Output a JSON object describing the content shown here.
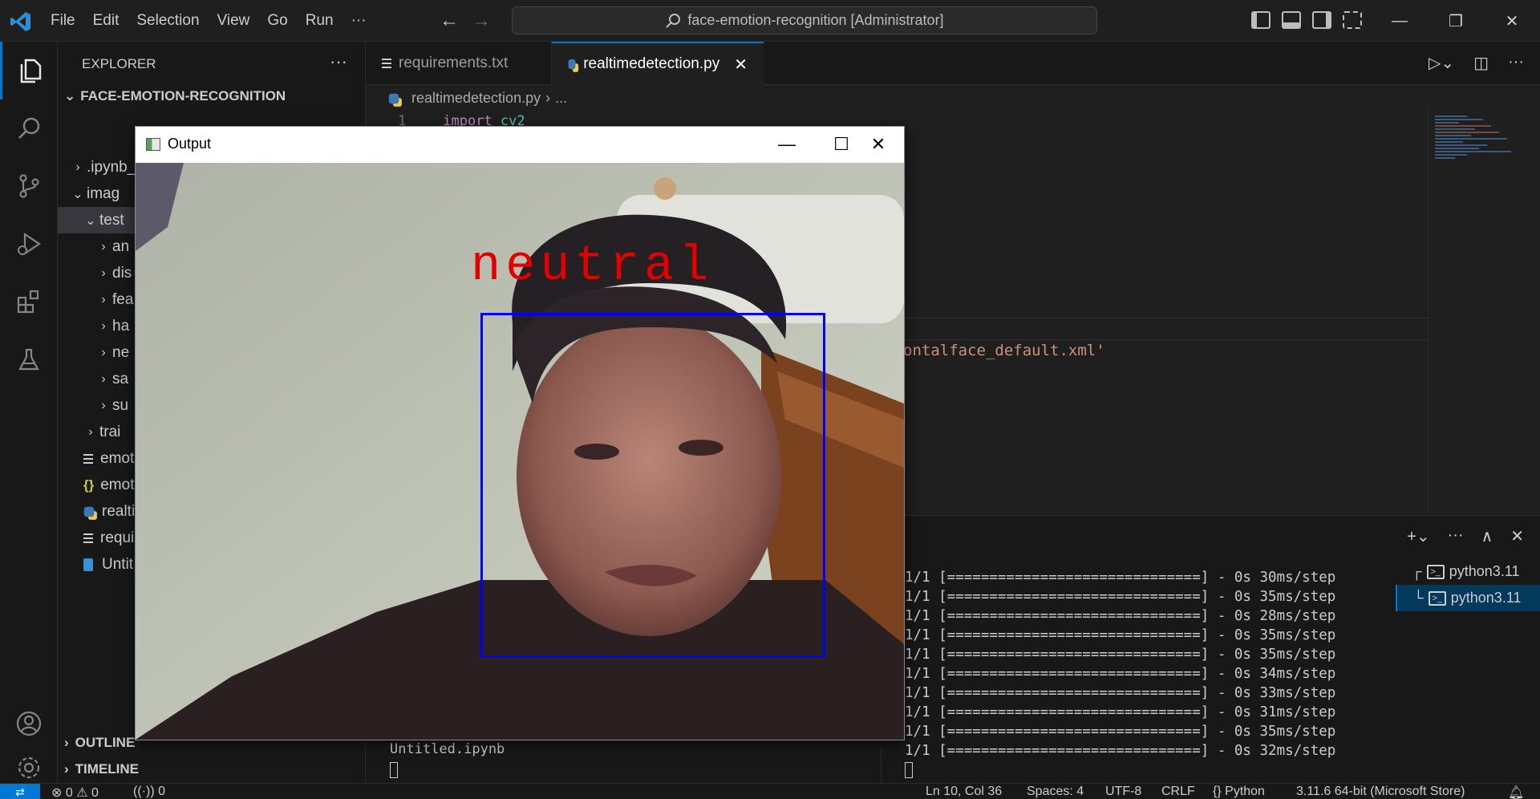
{
  "titlebar": {
    "menu": [
      "File",
      "Edit",
      "Selection",
      "View",
      "Go",
      "Run",
      "···"
    ],
    "command_center": "face-emotion-recognition [Administrator]"
  },
  "sidebar": {
    "title": "EXPLORER",
    "more": "···",
    "root": "FACE-EMOTION-RECOGNITION",
    "items": [
      {
        "label": ".ipynb_checkpoints",
        "chev": ">"
      },
      {
        "label": "imag",
        "chev": "v"
      },
      {
        "label": "test",
        "chev": "v"
      },
      {
        "label": "an",
        "chev": ">"
      },
      {
        "label": "dis",
        "chev": ">"
      },
      {
        "label": "fea",
        "chev": ">"
      },
      {
        "label": "ha",
        "chev": ">"
      },
      {
        "label": "ne",
        "chev": ">"
      },
      {
        "label": "sa",
        "chev": ">"
      },
      {
        "label": "su",
        "chev": ">"
      },
      {
        "label": "trai",
        "chev": ">"
      },
      {
        "label": "emot",
        "icon": "lines-icon"
      },
      {
        "label": "emot",
        "icon": "json-icon"
      },
      {
        "label": "realti",
        "icon": "python-icon"
      },
      {
        "label": "requi",
        "icon": "lines-icon"
      },
      {
        "label": "Untit",
        "icon": "notebook-icon"
      }
    ],
    "outline": "OUTLINE",
    "timeline": "TIMELINE"
  },
  "tabs": [
    {
      "label": "requirements.txt",
      "active": false
    },
    {
      "label": "realtimedetection.py",
      "active": true
    }
  ],
  "breadcrumb": {
    "file": "realtimedetection.py",
    "rest": "..."
  },
  "code": {
    "line_number": "1",
    "keyword": "import",
    "module": "cv2",
    "visible_string": "ontalface_default.xml'"
  },
  "panel": {
    "left_terminal_text": "Untitled.ipynb",
    "output_lines": [
      "1/1 [==============================] - 0s 30ms/step",
      "1/1 [==============================] - 0s 35ms/step",
      "1/1 [==============================] - 0s 28ms/step",
      "1/1 [==============================] - 0s 35ms/step",
      "1/1 [==============================] - 0s 35ms/step",
      "1/1 [==============================] - 0s 34ms/step",
      "1/1 [==============================] - 0s 33ms/step",
      "1/1 [==============================] - 0s 31ms/step",
      "1/1 [==============================] - 0s 35ms/step",
      "1/1 [==============================] - 0s 32ms/step"
    ],
    "terminals": [
      {
        "label": "python3.11",
        "prefix": "┌",
        "selected": false
      },
      {
        "label": "python3.11",
        "prefix": "└",
        "selected": true
      }
    ]
  },
  "statusbar": {
    "errors": "0",
    "warnings": "0",
    "ports": "0",
    "position": "Ln 10, Col 36",
    "spaces": "Spaces: 4",
    "encoding": "UTF-8",
    "eol": "CRLF",
    "language": "Python",
    "interpreter": "3.11.6 64-bit (Microsoft Store)"
  },
  "output_window": {
    "title": "Output",
    "emotion": "neutral"
  },
  "colors": {
    "accent": "#0078d4",
    "face_box": "#0000ff",
    "emotion_text": "#e20000"
  }
}
